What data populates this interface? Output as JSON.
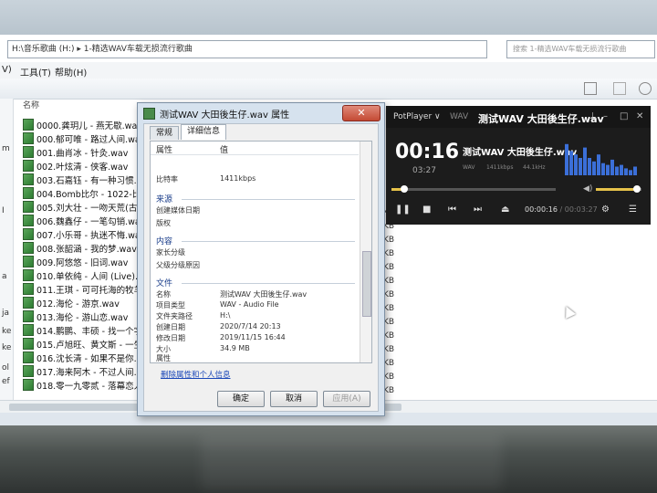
{
  "explorer": {
    "address": "H:\\音乐歌曲 (H:) ▸ 1-精选WAV车载无损流行歌曲",
    "search_placeholder": "搜索 1-精选WAV车载无损流行歌曲",
    "menu": [
      "V)",
      "工具(T)",
      "帮助(H)"
    ],
    "column_name": "名称",
    "left_marks": [
      "m",
      "I",
      "a",
      "ja",
      "ke",
      "ke",
      "ol",
      "ef"
    ],
    "files": [
      "0000.龚玥儿 - 燕无歇.wav",
      "000.郁可唯 - 路过人间.wav",
      "001.曲肖冰 - 针灸.wav",
      "002.叶炫清 - 侠客.wav",
      "003.石嘉钰 - 有一种习惯.wav",
      "004.Bomb比尔 - 1022-比尔的歌.wav",
      "005.刘大壮 - 一吻天荒(古筝版).wav",
      "006.魏鑫仔 - 一笔勾销.wav",
      "007.小乐哥 - 执迷不悔.wav",
      "008.张韶涵 - 我的梦.wav",
      "009.阿悠悠 - 旧词.wav",
      "010.单依纯 - 人间 (Live).wav",
      "011.王琪 - 可可托海的牧羊人.wav",
      "012.海伦 - 游京.wav",
      "013.海伦 - 游山恋.wav",
      "014.鹏鹏、丰硕 - 找一个字代替.wav",
      "015.卢旭旺、黄文斯 - 一生所爱.wav",
      "016.沈长清 - 如果不是你.wav",
      "017.海来阿木 - 不过人间.wav",
      "018.零一九零贰 - 落幕恋人.wav"
    ],
    "kb_labels": [
      "KB",
      "KB",
      "KB",
      "KB",
      "KB",
      "KB",
      "KB",
      "KB",
      "KB",
      "KB",
      "KB",
      "KB",
      "KB",
      "KB"
    ]
  },
  "dialog": {
    "title": "测试WAV 大田後生仔.wav 属性",
    "close_label": "✕",
    "tabs": [
      "常规",
      "详细信息"
    ],
    "col_property": "属性",
    "col_value": "值",
    "bitrate_label": "比特率",
    "bitrate_value": "1411kbps",
    "sections": {
      "source": "来源",
      "content": "内容",
      "file": "文件"
    },
    "source_rows": [
      "创建媒体日期",
      "版权"
    ],
    "content_rows": [
      "家长分级",
      "父级分级原因"
    ],
    "file_rows": [
      {
        "label": "名称",
        "value": "测试WAV 大田後生仔.wav"
      },
      {
        "label": "项目类型",
        "value": "WAV - Audio File"
      },
      {
        "label": "文件夹路径",
        "value": "H:\\"
      },
      {
        "label": "创建日期",
        "value": "2020/7/14 20:13"
      },
      {
        "label": "修改日期",
        "value": "2019/11/15 16:44"
      },
      {
        "label": "大小",
        "value": "34.9 MB"
      },
      {
        "label": "属性",
        "value": "A"
      }
    ],
    "remove_link": "删除属性和个人信息",
    "ok": "确定",
    "cancel": "取消",
    "apply": "应用(A)"
  },
  "player": {
    "app_name": "PotPlayer ∨",
    "format": "WAV",
    "title": "测试WAV 大田後生仔.wav",
    "elapsed": "00:16",
    "total_small": "03:27",
    "info1": "WAV",
    "info2": "1411kbps",
    "info3": "44.1kHz",
    "position": "00:00:16",
    "duration": "/ 00:03:27",
    "seek_fraction": 0.08,
    "volume_fraction": 0.9,
    "eq_levels": [
      0.9,
      0.7,
      0.6,
      0.5,
      0.8,
      0.5,
      0.4,
      0.6,
      0.35,
      0.3,
      0.45,
      0.25,
      0.3,
      0.2,
      0.15,
      0.25
    ],
    "accent_color": "#e6c24a",
    "eq_color": "#3b6fd8"
  }
}
